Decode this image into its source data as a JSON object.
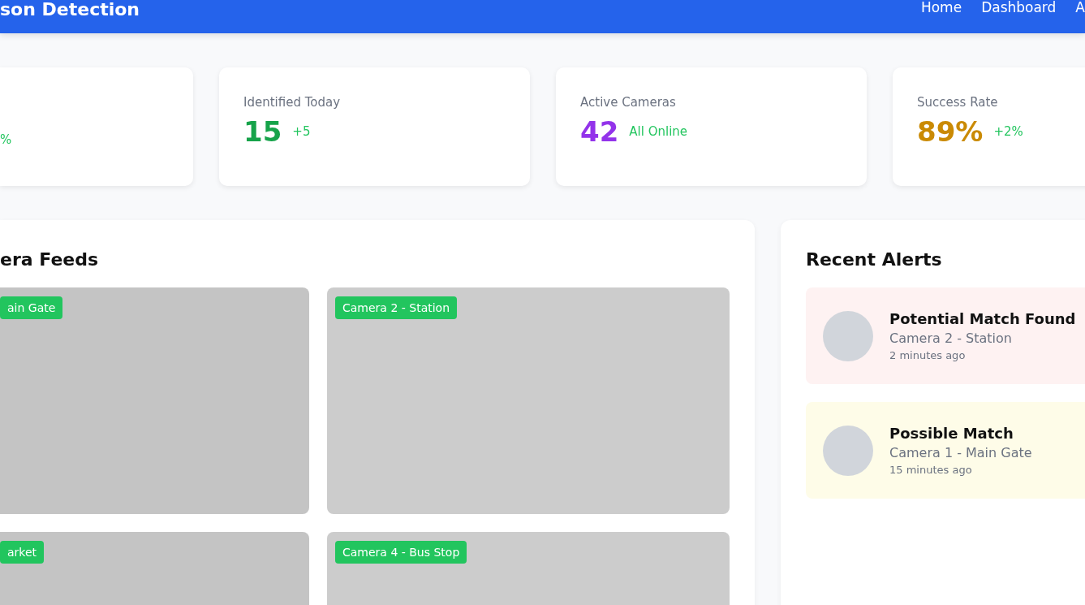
{
  "header": {
    "title": "son Detection",
    "nav": [
      {
        "label": "Home"
      },
      {
        "label": "Dashboard"
      },
      {
        "label": "A"
      }
    ]
  },
  "stats": [
    {
      "delta": "%",
      "color": "#22c55e"
    },
    {
      "label": "Identified Today",
      "value": "15",
      "delta": "+5",
      "color": "#16a34a"
    },
    {
      "label": "Active Cameras",
      "value": "42",
      "delta": "All Online",
      "color": "#9333ea"
    },
    {
      "label": "Success Rate",
      "value": "89%",
      "delta": "+2%",
      "color": "#ca8a04"
    }
  ],
  "feeds": {
    "title": "era Feeds",
    "cameras": [
      {
        "label": "ain Gate"
      },
      {
        "label": "Camera 2 - Station"
      },
      {
        "label": "arket"
      },
      {
        "label": "Camera 4 - Bus Stop"
      }
    ]
  },
  "alerts": {
    "title": "Recent Alerts",
    "items": [
      {
        "title": "Potential Match Found",
        "camera": "Camera 2 - Station",
        "time": "2 minutes ago",
        "color": "#fef2f2"
      },
      {
        "title": "Possible Match",
        "camera": "Camera 1 - Main Gate",
        "time": "15 minutes ago",
        "color": "#fefce8"
      }
    ]
  }
}
